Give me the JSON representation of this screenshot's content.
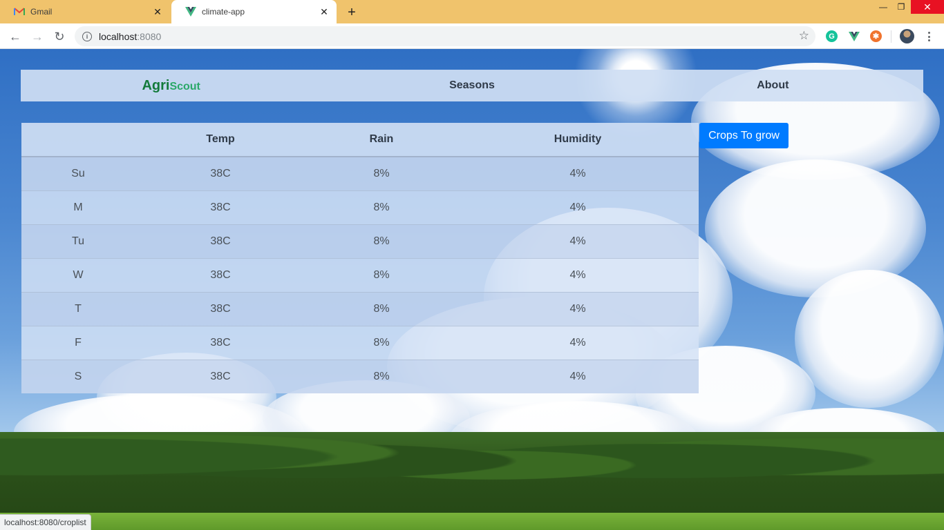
{
  "browser": {
    "tabs": [
      {
        "title": "Gmail",
        "icon": "gmail-icon",
        "active": false
      },
      {
        "title": "climate-app",
        "icon": "vue-icon",
        "active": true
      }
    ],
    "address": {
      "host": "localhost",
      "port": ":8080"
    },
    "status_url": "localhost:8080/croplist",
    "window": {
      "minimize": "—",
      "restore": "❐",
      "close": "✕"
    }
  },
  "app": {
    "brand": {
      "part1": "Agri",
      "part2": "Scout"
    },
    "nav": {
      "seasons": "Seasons",
      "about": "About"
    },
    "table": {
      "headers": [
        "",
        "Temp",
        "Rain",
        "Humidity"
      ],
      "rows": [
        [
          "Su",
          "38C",
          "8%",
          "4%"
        ],
        [
          "M",
          "38C",
          "8%",
          "4%"
        ],
        [
          "Tu",
          "38C",
          "8%",
          "4%"
        ],
        [
          "W",
          "38C",
          "8%",
          "4%"
        ],
        [
          "T",
          "38C",
          "8%",
          "4%"
        ],
        [
          "F",
          "38C",
          "8%",
          "4%"
        ],
        [
          "S",
          "38C",
          "8%",
          "4%"
        ]
      ]
    },
    "crops_button": "Crops To grow"
  },
  "colors": {
    "brand_dark": "#127a3a",
    "brand_light": "#2aa868",
    "button_primary": "#007bff",
    "tabbar": "#f0c36c"
  }
}
